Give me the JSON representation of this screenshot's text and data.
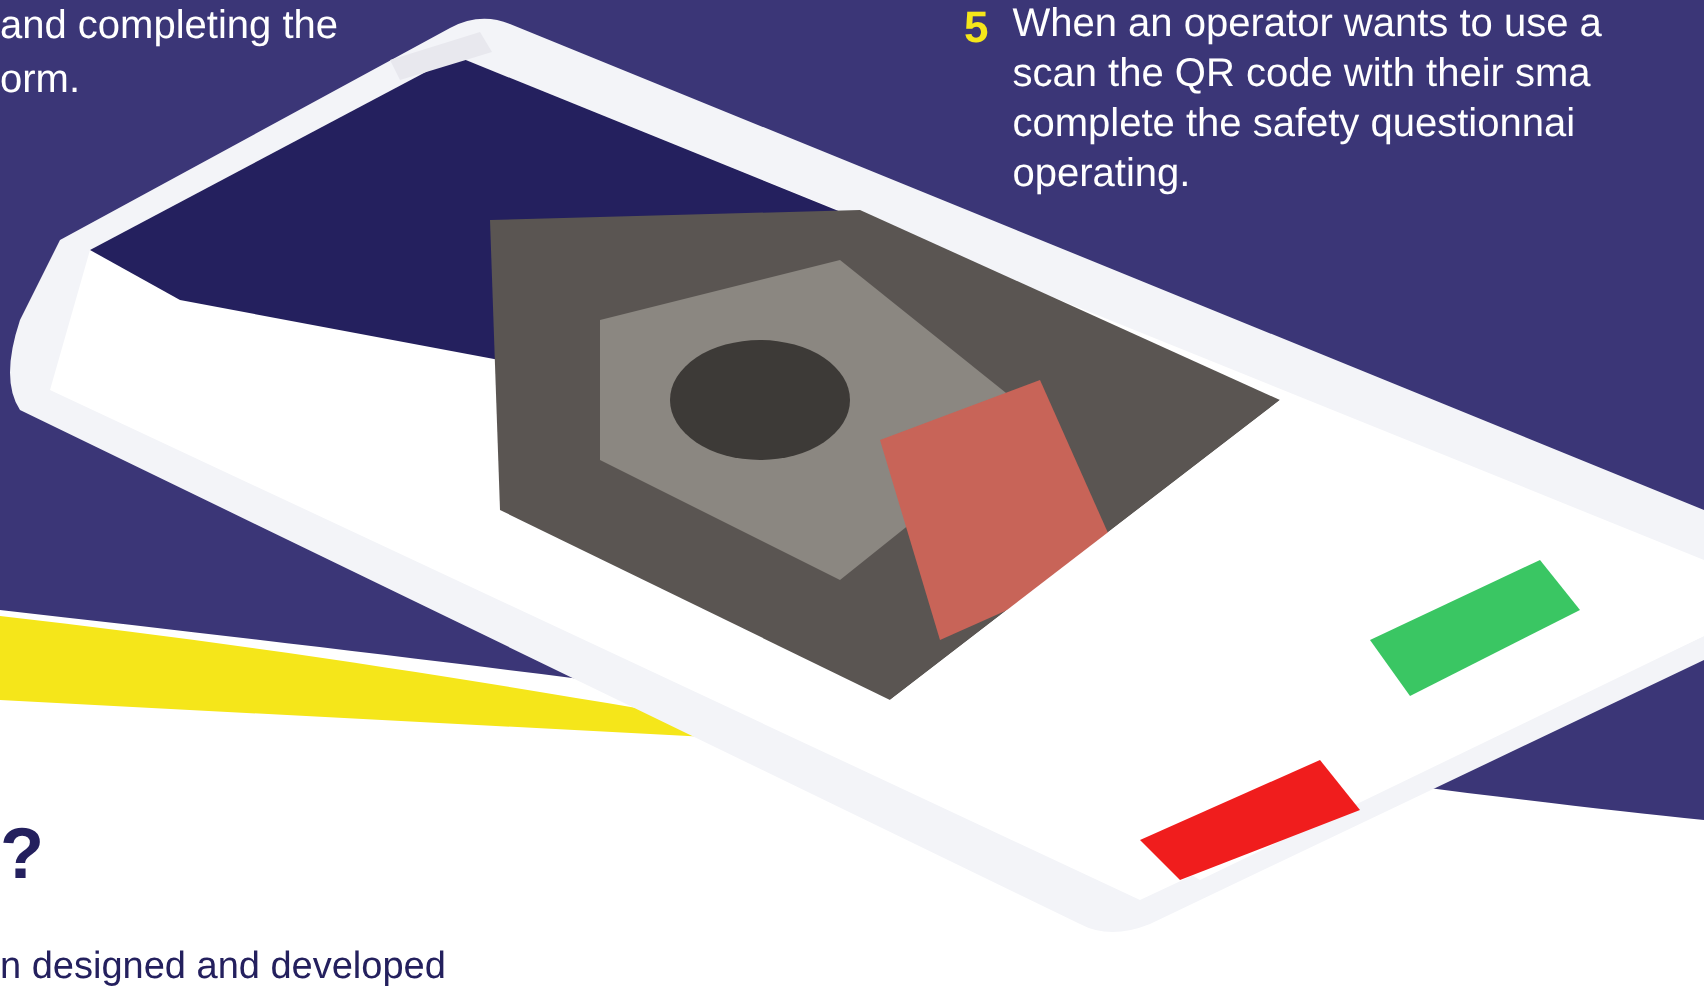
{
  "intro": {
    "lines": [
      "and completing the",
      "orm."
    ]
  },
  "step": {
    "number": "5",
    "lines": [
      "When an operator wants to use a",
      "scan the QR code with their sma",
      "complete the safety questionnai",
      "operating."
    ]
  },
  "section": {
    "heading": "?",
    "body": "n designed and developed"
  }
}
